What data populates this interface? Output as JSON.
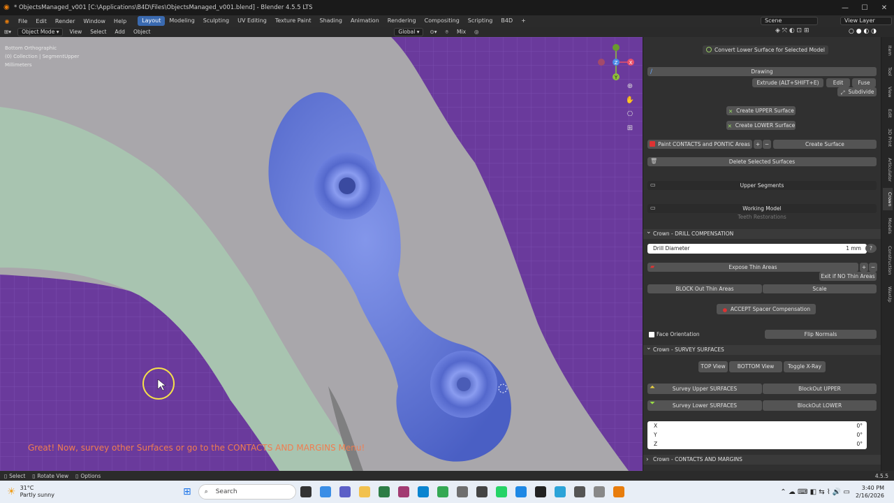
{
  "window": {
    "title": "* ObjectsManaged_v001 [C:\\Applications\\B4D\\Files\\ObjectsManaged_v001.blend] - Blender 4.5.5 LTS",
    "minimize": "—",
    "maximize": "☐",
    "close": "✕"
  },
  "menu": {
    "items": [
      "File",
      "Edit",
      "Render",
      "Window",
      "Help"
    ]
  },
  "workspaces": [
    {
      "label": "Layout",
      "active": true
    },
    {
      "label": "Modeling"
    },
    {
      "label": "Sculpting"
    },
    {
      "label": "UV Editing"
    },
    {
      "label": "Texture Paint"
    },
    {
      "label": "Shading"
    },
    {
      "label": "Animation"
    },
    {
      "label": "Rendering"
    },
    {
      "label": "Compositing"
    },
    {
      "label": "Scripting"
    },
    {
      "label": "B4D"
    }
  ],
  "add_workspace": "+",
  "scene": {
    "label": "Scene",
    "view_layer": "View Layer"
  },
  "header": {
    "mode": "Object Mode",
    "view": "View",
    "select": "Select",
    "add": "Add",
    "object": "Object",
    "orientation": "Global",
    "pivot": "Mix"
  },
  "viewport": {
    "view_name": "Bottom Orthographic",
    "collection": "(0) Collection | SegmentUpper",
    "units": "Millimeters",
    "message": "Great! Now, survey other Surfaces or go to the CONTACTS AND MARGINS Menu!",
    "gizmo": {
      "x": "X",
      "y": "Y",
      "z": "Z"
    }
  },
  "panel": {
    "convert_lower": "Convert Lower Surface for Selected Model",
    "drawing": "Drawing",
    "extrude": "Extrude  (ALT+SHIFT+E)",
    "edit": "Edit",
    "fuse": "Fuse",
    "subdivide": "Subdivide",
    "create_upper": "Create UPPER Surface",
    "create_lower": "Create LOWER Surface",
    "paint_contacts": "Paint CONTACTS and PONTIC Areas",
    "plus": "+",
    "minus": "−",
    "create_surface": "Create Surface",
    "delete_surfaces": "Delete Selected Surfaces",
    "upper_segments": "Upper Segments",
    "working_model": "Working Model",
    "teeth_restorations": "Teeth Restorations",
    "drill_section": "Crown - DRILL COMPENSATION",
    "drill_label": "Drill Diameter",
    "drill_value": "1 mm",
    "help": "?",
    "expose_thin": "Expose Thin Areas",
    "exit_thin": "Exit if NO Thin Areas",
    "block_out_thin": "BLOCK Out Thin Areas",
    "scale": "Scale",
    "accept_spacer": "ACCEPT Spacer Compensation",
    "face_orientation": "Face Orientation",
    "flip_normals": "Flip Normals",
    "survey_section": "Crown - SURVEY SURFACES",
    "top_view": "TOP View",
    "bottom_view": "BOTTOM View",
    "toggle_xray": "Toggle X-Ray",
    "survey_upper": "Survey Upper SURFACES",
    "blockout_upper": "BlockOut UPPER",
    "survey_lower": "Survey Lower SURFACES",
    "blockout_lower": "BlockOut LOWER",
    "rot": [
      {
        "axis": "X",
        "value": "0°"
      },
      {
        "axis": "Y",
        "value": "0°"
      },
      {
        "axis": "Z",
        "value": "0°"
      }
    ],
    "contacts_section": "Crown - CONTACTS AND MARGINS"
  },
  "tabs": [
    "Item",
    "Tool",
    "View",
    "Edit",
    "3D Print",
    "Articulator",
    "Crown",
    "Models",
    "Construction",
    "WaxUp"
  ],
  "status": {
    "select": "Select",
    "rotate": "Rotate View",
    "options": "Options",
    "version": "4.5.5"
  },
  "taskbar": {
    "temp": "31°C",
    "weather": "Partly sunny",
    "search": "Search",
    "time": "3:40 PM",
    "date": "2/16/2026"
  },
  "colors": {
    "viewport_bg": "#6a3a9c",
    "accent": "#3a6ab0",
    "mesh_blue": "#5f76d6",
    "mesh_green": "#a9c6b2",
    "message": "#f07d50"
  }
}
